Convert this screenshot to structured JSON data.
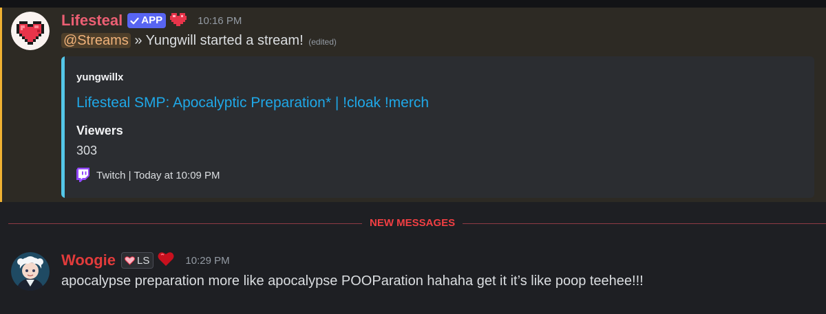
{
  "colors": {
    "lifesteal_name": "#ec5f73",
    "woogie_name": "#e23b3b",
    "app_badge": "#5865f2",
    "mention_bar": "#f0b232",
    "embed_bar": "#54c7e8",
    "link": "#1fa8e8",
    "new_messages": "#f23f43"
  },
  "message1": {
    "avatar_icon": "pixel-heart-icon",
    "username": "Lifesteal",
    "app_badge": "APP",
    "role_icon": "pixel-heart-icon",
    "timestamp": "10:16 PM",
    "mention": "@Streams",
    "text": " » Yungwill started a stream!",
    "edited": "(edited)",
    "embed": {
      "author": "yungwillx",
      "title": "Lifesteal SMP: Apocalyptic Preparation* | !cloak !merch",
      "field_name": "Viewers",
      "field_value": "303",
      "footer_icon": "twitch-icon",
      "footer": "Twitch | Today at 10:09 PM"
    }
  },
  "divider": {
    "label": "NEW MESSAGES"
  },
  "message2": {
    "avatar_icon": "anime-character-avatar",
    "username": "Woogie",
    "badge_icon": "heart-icon",
    "badge_label": "LS",
    "role_icon": "red-heart-icon",
    "timestamp": "10:29 PM",
    "text": "apocalypse preparation more like apocalypse POOParation hahaha get it it’s like poop teehee!!!"
  }
}
